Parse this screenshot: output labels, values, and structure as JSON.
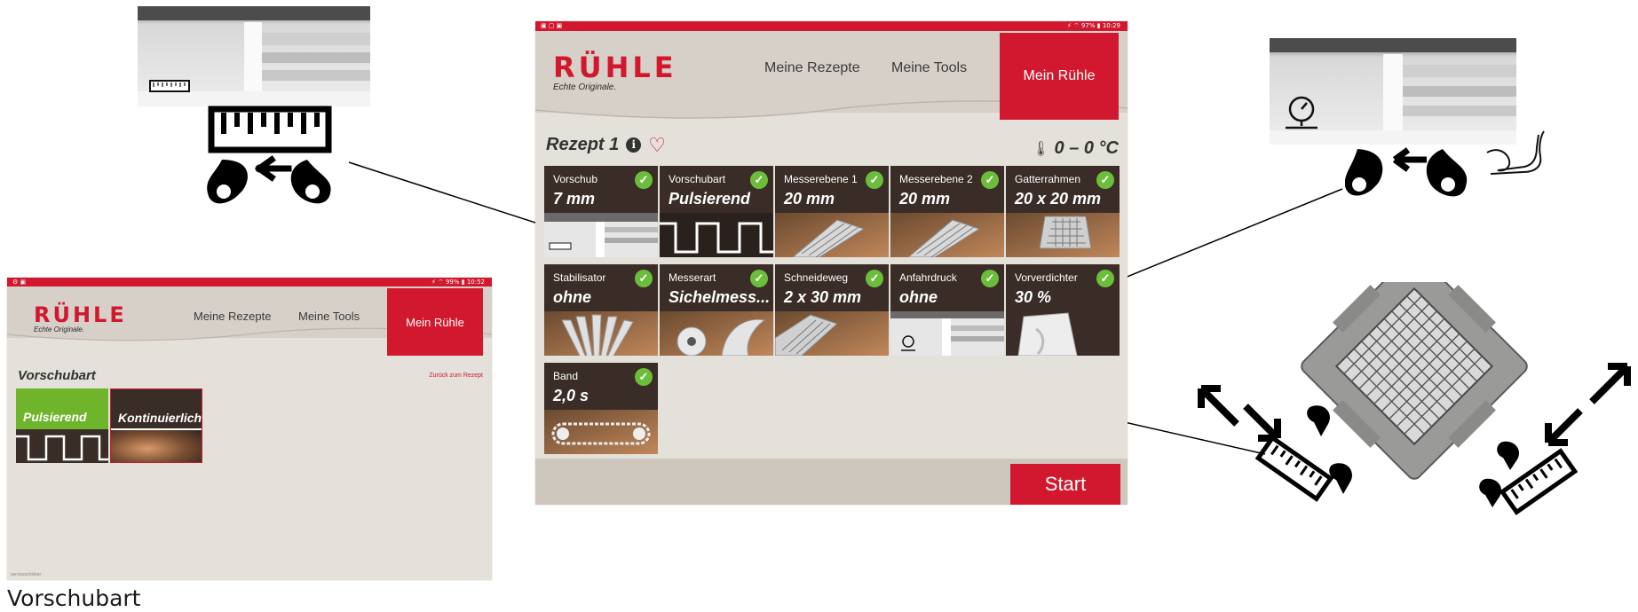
{
  "main": {
    "status_left": "▣ ▢ ▣",
    "status_right": "⚡ ⌔ 97% ▮ 10:29",
    "logo_word": "RÜHLE",
    "logo_tagline": "Echte Originale.",
    "nav": [
      "Meine Rezepte",
      "Meine Tools",
      "Mein Rühle"
    ],
    "recipe_title": "Rezept 1",
    "temperature": "0 – 0 °C",
    "tiles": [
      {
        "label": "Vorschub",
        "value": "7 mm"
      },
      {
        "label": "Vorschubart",
        "value": "Pulsierend"
      },
      {
        "label": "Messerebene 1",
        "value": "20 mm"
      },
      {
        "label": "Messerebene 2",
        "value": "20 mm"
      },
      {
        "label": "Gatterrahmen",
        "value": "20 x 20 mm"
      },
      {
        "label": "Stabilisator",
        "value": "ohne"
      },
      {
        "label": "Messerart",
        "value": "Sichelmess..."
      },
      {
        "label": "Schneideweg",
        "value": "2 x 30 mm"
      },
      {
        "label": "Anfahrdruck",
        "value": "ohne"
      },
      {
        "label": "Vorverdichter",
        "value": "30 %"
      },
      {
        "label": "Band",
        "value": "2,0 s"
      }
    ],
    "start_label": "Start"
  },
  "small": {
    "status_left": "⚙ ▣",
    "status_right": "⚡ ⌔ 99% ▮ 10:52",
    "logo_word": "RÜHLE",
    "logo_tagline": "Echte Originale.",
    "nav": [
      "Meine Rezepte",
      "Meine Tools",
      "Mein Rühle"
    ],
    "title": "Vorschubart",
    "back_link": "Zurück zum Rezept",
    "options": [
      "Pulsierend",
      "Kontinuierlich"
    ],
    "footer": "serviceschicker"
  },
  "caption": "Vorschubart",
  "colors": {
    "brand_red": "#d2182e",
    "check_green": "#6dbd3d",
    "selected_green": "#6fb52c",
    "tile_dark": "#3a2c26",
    "panel_bg": "#e4e0da"
  }
}
